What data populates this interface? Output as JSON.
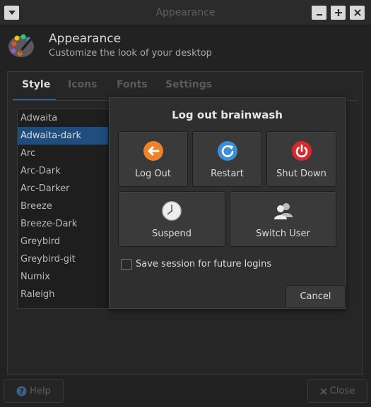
{
  "window": {
    "title": "Appearance"
  },
  "header": {
    "title": "Appearance",
    "subtitle": "Customize the look of your desktop"
  },
  "tabs": [
    "Style",
    "Icons",
    "Fonts",
    "Settings"
  ],
  "active_tab": "Style",
  "themes": [
    "Adwaita",
    "Adwaita-dark",
    "Arc",
    "Arc-Dark",
    "Arc-Darker",
    "Breeze",
    "Breeze-Dark",
    "Greybird",
    "Greybird-git",
    "Numix",
    "Raleigh"
  ],
  "selected_theme": "Adwaita-dark",
  "footer": {
    "help_label": "Help",
    "close_label": "Close"
  },
  "logout_dialog": {
    "title": "Log out brainwash",
    "actions": [
      {
        "label": "Log Out",
        "icon": "log-out-icon",
        "color": "#f0822a"
      },
      {
        "label": "Restart",
        "icon": "restart-icon",
        "color": "#3b8fd8"
      },
      {
        "label": "Shut Down",
        "icon": "shutdown-icon",
        "color": "#d8292d"
      },
      {
        "label": "Suspend",
        "icon": "suspend-clock-icon",
        "color": "#eeeeee"
      },
      {
        "label": "Switch User",
        "icon": "switch-user-icon",
        "color": "#d8d8d8"
      }
    ],
    "save_session_label": "Save session for future logins",
    "save_session_checked": false,
    "cancel_label": "Cancel"
  },
  "colors": {
    "selection": "#1f4d7e",
    "tab_underline": "#2f5f8f"
  }
}
